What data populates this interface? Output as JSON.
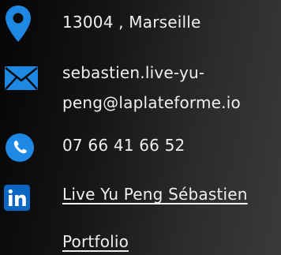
{
  "contact": {
    "location": {
      "icon": "location-pin-icon",
      "text": "13004 , Marseille"
    },
    "email": {
      "icon": "envelope-icon",
      "line1": "sebastien.live-yu-",
      "line2": "peng@laplateforme.io"
    },
    "phone": {
      "icon": "phone-icon",
      "text": "07 66 41 66 52"
    },
    "linkedin": {
      "icon": "linkedin-icon",
      "text": "Live Yu Peng Sébastien"
    },
    "portfolio": {
      "text": "Portfolio"
    }
  },
  "colors": {
    "accent": "#1e88e5",
    "linkedin": "#0a66c2",
    "text": "#f0f0f0"
  }
}
